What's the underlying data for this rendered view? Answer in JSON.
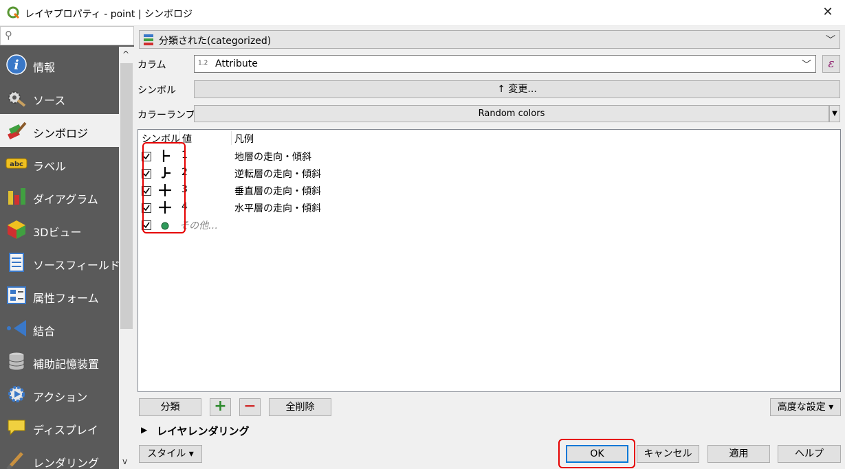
{
  "window": {
    "title": "レイヤプロパティ - point | シンボロジ"
  },
  "sidebar": {
    "items": [
      {
        "label": "情報",
        "icon": "info-icon"
      },
      {
        "label": "ソース",
        "icon": "source-gear-icon"
      },
      {
        "label": "シンボロジ",
        "icon": "symbology-brush-icon",
        "active": true
      },
      {
        "label": "ラベル",
        "icon": "abc-label-icon"
      },
      {
        "label": "ダイアグラム",
        "icon": "diagram-icon"
      },
      {
        "label": "3Dビュー",
        "icon": "cube-3d-icon"
      },
      {
        "label": "ソースフィールド",
        "icon": "fields-icon"
      },
      {
        "label": "属性フォーム",
        "icon": "form-icon"
      },
      {
        "label": "結合",
        "icon": "join-icon"
      },
      {
        "label": "補助記憶装置",
        "icon": "database-icon"
      },
      {
        "label": "アクション",
        "icon": "action-gear-icon"
      },
      {
        "label": "ディスプレイ",
        "icon": "display-speech-icon"
      },
      {
        "label": "レンダリング",
        "icon": "rendering-brush-icon"
      }
    ]
  },
  "renderer": {
    "label": "分類された(categorized)"
  },
  "form": {
    "column_label": "カラム",
    "column_type": "1.2",
    "column_value": "Attribute",
    "symbol_label": "シンボル",
    "symbol_button": "↑ 変更...",
    "ramp_label": "カラーランプ",
    "ramp_value": "Random colors",
    "expression_glyph": "ε"
  },
  "tree": {
    "headers": {
      "symbol": "シンボル",
      "value": "値",
      "legend": "凡例"
    },
    "rows": [
      {
        "value": "1",
        "legend": "地層の走向・傾斜",
        "symbol": "strike-dip-icon",
        "checked": true
      },
      {
        "value": "2",
        "legend": "逆転層の走向・傾斜",
        "symbol": "overturned-bed-icon",
        "checked": true
      },
      {
        "value": "3",
        "legend": "垂直層の走向・傾斜",
        "symbol": "vertical-bed-icon",
        "checked": true
      },
      {
        "value": "4",
        "legend": "水平層の走向・傾斜",
        "symbol": "horizontal-bed-icon",
        "checked": true
      },
      {
        "value": "その他…",
        "legend": "",
        "symbol": "green-dot-icon",
        "checked": true,
        "other": true
      }
    ]
  },
  "buttons": {
    "classify": "分類",
    "add": "+",
    "remove": "−",
    "delete_all": "全削除",
    "advanced": "高度な設定 ▾",
    "style": "スタイル ▾",
    "ok": "OK",
    "cancel": "キャンセル",
    "apply": "適用",
    "help": "ヘルプ"
  },
  "layer_rendering": {
    "label": "レイヤレンダリング"
  },
  "colors": {
    "sidebar": "#5a5a5a",
    "highlight_red": "#e60000",
    "ok_border": "#0078d7",
    "other_dot": "#2e9a5a"
  }
}
